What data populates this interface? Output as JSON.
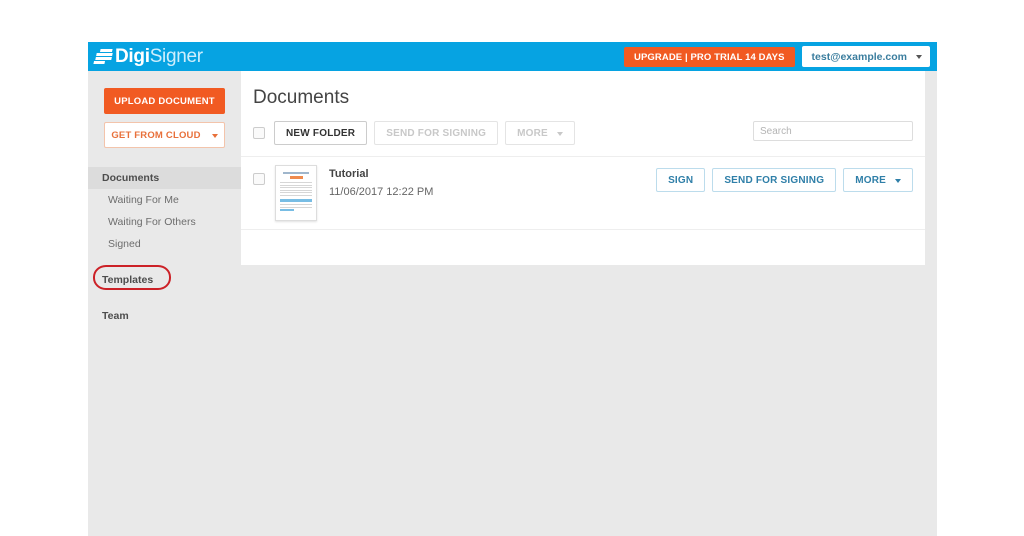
{
  "header": {
    "logo_primary": "Digi",
    "logo_secondary": "Signer",
    "logo_icon": "digisigner-logo-icon",
    "upgrade_label": "UPGRADE | PRO TRIAL 14 DAYS",
    "account_email": "test@example.com",
    "account_caret_icon": "chevron-down-icon",
    "bar_color": "#06a3e2",
    "upgrade_color": "#f15a22"
  },
  "sidebar": {
    "upload_label": "UPLOAD DOCUMENT",
    "cloud_label": "GET FROM CLOUD",
    "cloud_caret_icon": "chevron-down-icon",
    "items": [
      {
        "label": "Documents",
        "active": true
      },
      {
        "label": "Waiting For Me",
        "active": false
      },
      {
        "label": "Waiting For Others",
        "active": false
      },
      {
        "label": "Signed",
        "active": false
      },
      {
        "label": "Templates",
        "active": false
      },
      {
        "label": "Team",
        "active": false
      }
    ],
    "annotation": {
      "target": "Templates",
      "shape": "ellipse",
      "color": "#cc2127"
    }
  },
  "main": {
    "title": "Documents",
    "toolbar": {
      "select_all_checkbox": "unchecked",
      "new_folder_label": "NEW FOLDER",
      "send_for_signing_label": "SEND FOR SIGNING",
      "more_label": "MORE",
      "more_caret_icon": "chevron-down-icon"
    },
    "search": {
      "placeholder": "Search",
      "value": "",
      "icon": "search-input"
    },
    "documents": [
      {
        "checkbox": "unchecked",
        "thumbnail_icon": "document-thumbnail",
        "name": "Tutorial",
        "date": "11/06/2017 12:22 PM",
        "actions": {
          "sign_label": "SIGN",
          "send_label": "SEND FOR SIGNING",
          "more_label": "MORE",
          "more_caret_icon": "chevron-down-icon"
        }
      }
    ]
  }
}
